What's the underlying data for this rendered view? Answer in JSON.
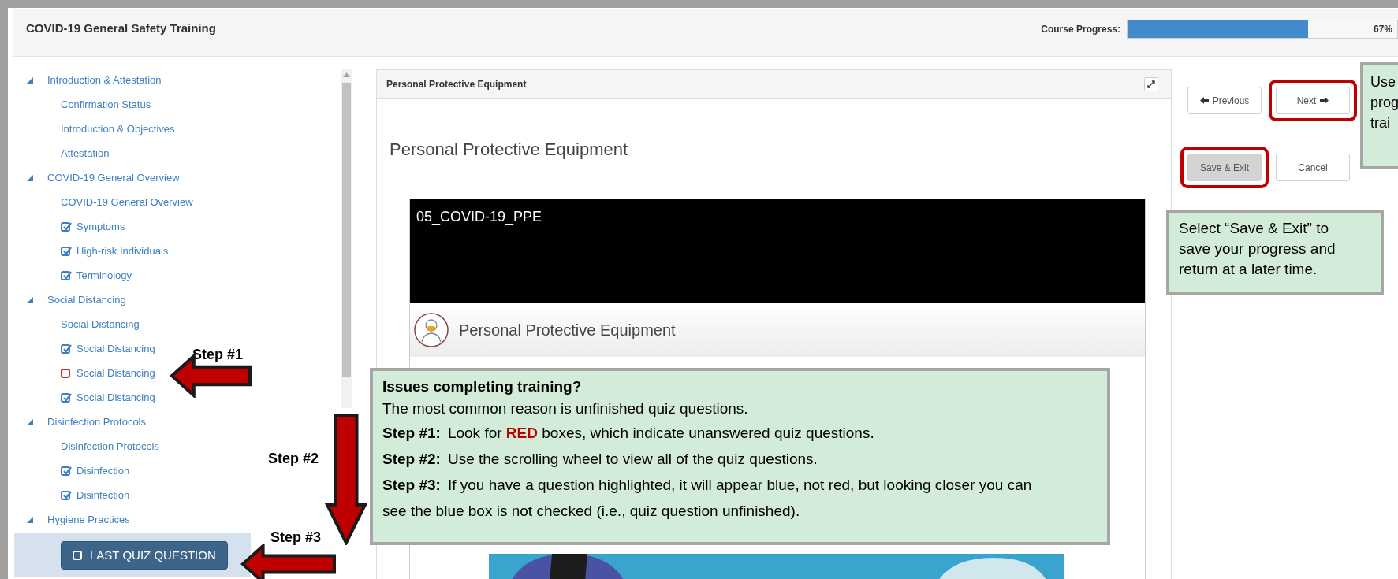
{
  "header": {
    "title": "COVID-19 General Safety Training",
    "progress_label": "Course Progress:",
    "progress": {
      "level": 0.67,
      "reading": "67%"
    }
  },
  "sidebar": {
    "sections": [
      {
        "label": "Introduction & Attestation",
        "expanded": true,
        "children": [
          {
            "label": "Confirmation Status",
            "kind": "page",
            "selected": false
          },
          {
            "label": "Introduction & Objectives",
            "kind": "page",
            "selected": false
          },
          {
            "label": "Attestation",
            "kind": "page",
            "selected": false
          }
        ]
      },
      {
        "label": "COVID-19 General Overview",
        "expanded": true,
        "children": [
          {
            "label": "COVID-19 General Overview",
            "kind": "page",
            "selected": false
          },
          {
            "label": "Symptoms",
            "kind": "quiz",
            "checked": true,
            "selected": false
          },
          {
            "label": "High-risk Individuals",
            "kind": "quiz",
            "checked": true,
            "selected": false
          },
          {
            "label": "Terminology",
            "kind": "quiz",
            "checked": true,
            "selected": false
          }
        ]
      },
      {
        "label": "Social Distancing",
        "expanded": true,
        "children": [
          {
            "label": "Social Distancing",
            "kind": "page",
            "selected": false
          },
          {
            "label": "Social Distancing",
            "kind": "quiz",
            "checked": true,
            "selected": false
          },
          {
            "label": "Social Distancing",
            "kind": "quiz",
            "checked": false,
            "selected": false
          },
          {
            "label": "Social Distancing",
            "kind": "quiz",
            "checked": true,
            "selected": false
          }
        ]
      },
      {
        "label": "Disinfection Protocols",
        "expanded": true,
        "children": [
          {
            "label": "Disinfection Protocols",
            "kind": "page",
            "selected": false
          },
          {
            "label": "Disinfection",
            "kind": "quiz",
            "checked": true,
            "selected": false
          },
          {
            "label": "Disinfection",
            "kind": "quiz",
            "checked": true,
            "selected": false
          }
        ]
      },
      {
        "label": "Hygiene Practices",
        "expanded": true,
        "children": [
          {
            "label": "LAST QUIZ QUESTION",
            "kind": "quiz",
            "checked": false,
            "selected": true
          }
        ]
      }
    ]
  },
  "content": {
    "panel_title": "Personal Protective Equipment",
    "heading": "Personal Protective Equipment",
    "video": {
      "title": "05_COVID-19_PPE",
      "slide_title": "Personal Protective Equipment"
    }
  },
  "navigation": {
    "rows": [
      [
        {
          "label": "Previous",
          "kind": "back",
          "highlighted": false
        },
        {
          "label": "Next",
          "kind": "forward",
          "highlighted": true
        }
      ],
      [
        {
          "label": "Save & Exit",
          "kind": "shaded",
          "highlighted": true
        },
        {
          "label": "Cancel",
          "kind": "default",
          "highlighted": false
        }
      ]
    ]
  },
  "annotations": {
    "callouts": [
      {
        "lines": [
          "Use",
          "prog",
          "trai"
        ]
      },
      {
        "lines": [
          "Select “Save & Exit” to save your progress and return at a later time."
        ]
      },
      {
        "title": "Issues completing training?",
        "intro": "The most common reason is unfinished quiz questions.",
        "steps": [
          {
            "label": "Step #1:",
            "text": "Look for **RED** boxes, which indicate unanswered quiz questions."
          },
          {
            "label": "Step #2:",
            "text": "Use the scrolling wheel to view all of the quiz questions."
          },
          {
            "label": "Step #3:",
            "text": "If you have a question highlighted, it will appear blue, not red, but looking closer you can see the blue box is not checked (i.e., quiz question unfinished)."
          }
        ]
      }
    ],
    "steps": [
      {
        "label": "Step #1",
        "kind": "left"
      },
      {
        "label": "Step #2",
        "kind": "down"
      },
      {
        "label": "Step #3",
        "kind": "left"
      }
    ]
  }
}
